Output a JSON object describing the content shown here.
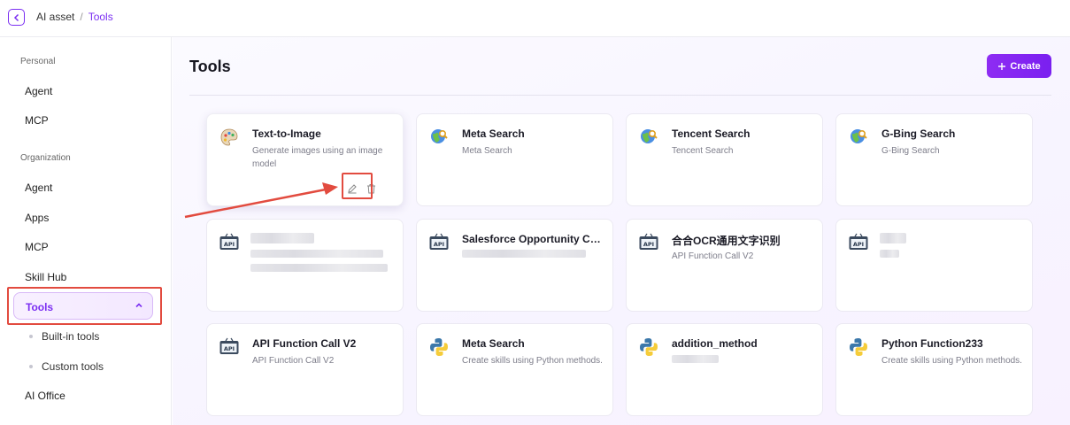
{
  "header": {
    "breadcrumb": [
      "AI asset",
      "/",
      "Tools"
    ]
  },
  "sidebar": {
    "personal_title": "Personal",
    "personal_items": [
      "Agent",
      "MCP"
    ],
    "org_title": "Organization",
    "org_items": [
      "Agent",
      "Apps",
      "MCP",
      "Skill Hub"
    ],
    "active_item": "Tools",
    "sub_items": [
      "Built-in tools",
      "Custom tools"
    ],
    "last_item": "AI Office"
  },
  "main": {
    "title": "Tools",
    "create_label": "Create",
    "cards": [
      {
        "name": "Text-to-Image",
        "desc": "Generate images using an image model",
        "icon": "palette-icon"
      },
      {
        "name": "Meta Search",
        "desc": "Meta Search",
        "icon": "globe-search-icon"
      },
      {
        "name": "Tencent Search",
        "desc": "Tencent Search",
        "icon": "globe-search-icon"
      },
      {
        "name": "G-Bing Search",
        "desc": "G-Bing Search",
        "icon": "globe-search-icon"
      },
      {
        "name": "",
        "desc": "",
        "icon": "api-icon"
      },
      {
        "name": "Salesforce Opportunity Creati...",
        "desc": "",
        "icon": "api-icon"
      },
      {
        "name": "合合OCR通用文字识别",
        "desc": "API Function Call V2",
        "icon": "api-icon"
      },
      {
        "name": "",
        "desc": "",
        "icon": "api-icon"
      },
      {
        "name": "API Function Call V2",
        "desc": "API Function Call V2",
        "icon": "api-icon"
      },
      {
        "name": "Meta Search",
        "desc": "Create skills using Python methods.",
        "icon": "python-icon"
      },
      {
        "name": "addition_method",
        "desc": "",
        "icon": "python-icon"
      },
      {
        "name": "Python Function233",
        "desc": "Create skills using Python methods.",
        "icon": "python-icon"
      }
    ]
  },
  "colors": {
    "accent": "#7b2ff2",
    "highlight": "#e24b3f"
  }
}
